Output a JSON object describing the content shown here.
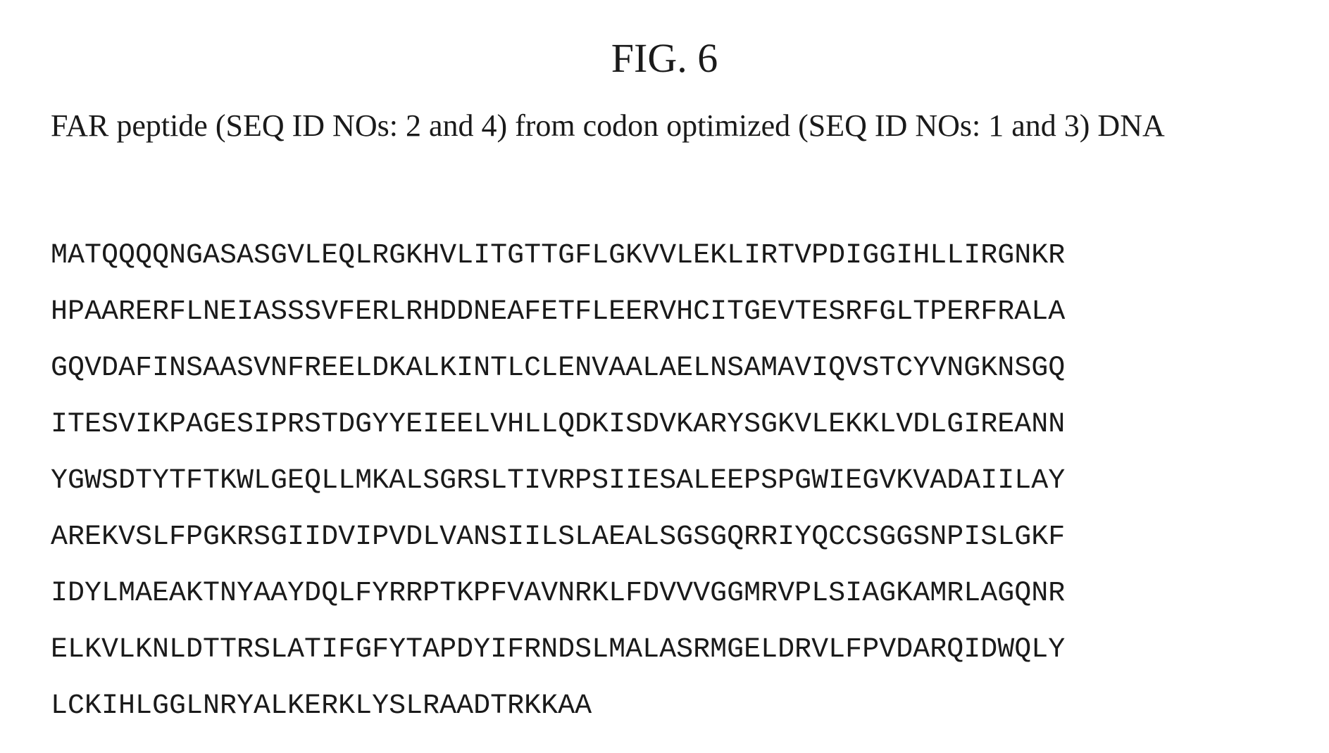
{
  "figure": {
    "title": "FIG. 6",
    "caption": "FAR peptide (SEQ ID NOs: 2 and 4) from codon optimized (SEQ ID NOs: 1 and 3) DNA"
  },
  "sequence_lines": [
    "MATQQQQNGASASGVLEQLRGKHVLITGTTGFLGKVVLEKLIRTVPDIGGIHLLIRGNKR",
    "HPAARERFLNEIASSSVFERLRHDDNEAFETFLEERVHCITGEVTESRFGLTPERFRALA",
    "GQVDAFINSAASVNFREELDKALKINTLCLENVAALAELNSAMAVIQVSTCYVNGKNSGQ",
    "ITESVIKPAGESIPRSTDGYYEIEELVHLLQDKISDVKARYSGKVLEKKLVDLGIREANN",
    "YGWSDTYTFTKWLGEQLLMKALSGRSLTIVRPSIIESALEEPSPGWIEGVKVADAIILAY",
    "AREKVSLFPGKRSGIIDVIPVDLVANSIILSLAEALSGSGQRRIYQCCSGGSNPISLGKF",
    "IDYLMAEAKTNYAAYDQLFYRRPTKPFVAVNRKLFDVVVGGMRVPLSIAGKAMRLAGQNR",
    "ELKVLKNLDTTRSLATIFGFYTAPDYIFRNDSLMALASRMGELDRVLFPVDARQIDWQLY",
    "LCKIHLGGLNRYALKERKLYSLRAADTRKKAA"
  ]
}
